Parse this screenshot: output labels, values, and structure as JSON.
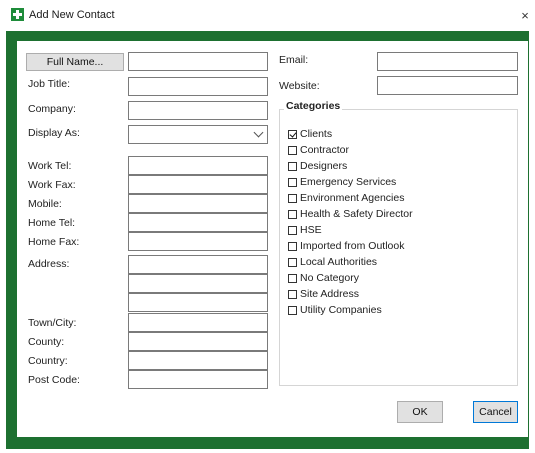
{
  "window": {
    "title": "Add New Contact",
    "close_glyph": "×",
    "icon": "add-contact-icon"
  },
  "form": {
    "full_name_button": "Full Name...",
    "job_title": "Job Title:",
    "company": "Company:",
    "display_as": "Display As:",
    "work_tel": "Work Tel:",
    "work_fax": "Work Fax:",
    "mobile": "Mobile:",
    "home_tel": "Home Tel:",
    "home_fax": "Home Fax:",
    "address": "Address:",
    "town_city": "Town/City:",
    "county": "County:",
    "country": "Country:",
    "post_code": "Post Code:",
    "email": "Email:",
    "website": "Website:"
  },
  "categories": {
    "title": "Categories",
    "items": [
      {
        "label": "Clients",
        "checked": true
      },
      {
        "label": "Contractor",
        "checked": false
      },
      {
        "label": "Designers",
        "checked": false
      },
      {
        "label": "Emergency Services",
        "checked": false
      },
      {
        "label": "Environment Agencies",
        "checked": false
      },
      {
        "label": "Health & Safety Director",
        "checked": false
      },
      {
        "label": "HSE",
        "checked": false
      },
      {
        "label": "Imported from Outlook",
        "checked": false
      },
      {
        "label": "Local Authorities",
        "checked": false
      },
      {
        "label": "No Category",
        "checked": false
      },
      {
        "label": "Site Address",
        "checked": false
      },
      {
        "label": "Utility Companies",
        "checked": false
      }
    ]
  },
  "buttons": {
    "ok": "OK",
    "cancel": "Cancel"
  },
  "colors": {
    "frame": "#1d7030",
    "icon": "#1e8c3a",
    "focus_border": "#0078d7"
  }
}
